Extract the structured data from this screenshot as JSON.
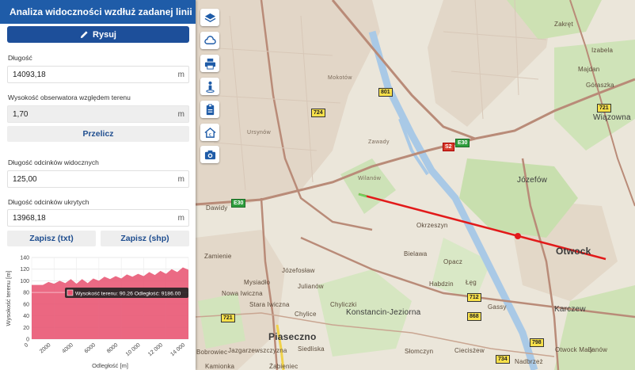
{
  "panel": {
    "title": "Analiza widoczności wzdłuż zadanej linii",
    "draw_button": "Rysuj",
    "length_label": "Długość",
    "length_value": "14093,18",
    "length_unit": "m",
    "observer_label": "Wysokość obserwatora względem terenu",
    "observer_value": "1,70",
    "observer_unit": "m",
    "recalc_button": "Przelicz",
    "visible_label": "Długość odcinków widocznych",
    "visible_value": "125,00",
    "visible_unit": "m",
    "hidden_label": "Długość odcinków ukrytych",
    "hidden_value": "13968,18",
    "hidden_unit": "m",
    "save_txt": "Zapisz (txt)",
    "save_shp": "Zapisz (shp)"
  },
  "chart_data": {
    "type": "area",
    "ylabel": "Wysokość terenu [m]",
    "xlabel": "Odległość [m]",
    "xlim": [
      0,
      14000
    ],
    "ylim": [
      0,
      140
    ],
    "x_ticks": [
      "0",
      "2000",
      "4000",
      "6000",
      "8000",
      "10 000",
      "12 000",
      "14 000"
    ],
    "y_ticks": [
      "0",
      "20",
      "40",
      "60",
      "80",
      "100",
      "120",
      "140"
    ],
    "grid": true,
    "series_color": "#e8506e",
    "x": [
      0,
      1000,
      1500,
      2000,
      2500,
      3000,
      3500,
      4000,
      4500,
      5000,
      5500,
      6000,
      6500,
      7000,
      7500,
      8000,
      8500,
      9000,
      9500,
      10000,
      10500,
      11000,
      11500,
      12000,
      12500,
      13000,
      13500,
      14093
    ],
    "y": [
      93,
      93,
      95,
      98,
      97,
      99,
      100,
      98,
      100,
      99,
      101,
      103,
      104,
      106,
      105,
      107,
      108,
      110,
      109,
      111,
      112,
      113,
      114,
      115,
      117,
      118,
      120,
      122
    ],
    "tooltip_text": "Wysokość terenu: 90.26 Odległość: 9186.00"
  },
  "map": {
    "places": [
      "Zakręt",
      "Izabela",
      "Majdan",
      "Góraszka",
      "Wiązowna",
      "Józefów",
      "Otwock",
      "Karczew",
      "Okrzeszyn",
      "Bielawa",
      "Opacz",
      "Habdzin",
      "Łęg",
      "Gassy",
      "Konstancin-Jeziorna",
      "Piaseczno",
      "Julianów",
      "Chylice",
      "Chyliczki",
      "Siedliska",
      "Mysiadło",
      "Józefosław",
      "Zamienie",
      "Nowa Iwiczna",
      "Stara Iwiczna",
      "Dawidy",
      "Słomczyn",
      "Ciecisżew",
      "Bobrowiec",
      "Jazgarzewszczyzna",
      "Kamionka",
      "Żabieniec",
      "Nadbrzeż",
      "Otwock Mały",
      "Janów",
      "Wilanów",
      "Zawady",
      "Mokotów",
      "Ursynów"
    ],
    "roads": [
      "801",
      "724",
      "S2",
      "E30",
      "721",
      "712",
      "868",
      "798",
      "734",
      "E30",
      "721"
    ]
  },
  "tools": [
    "layers-icon",
    "cloud-icon",
    "print-icon",
    "person-icon",
    "clipboard-icon",
    "home-euro-icon",
    "camera-icon"
  ]
}
